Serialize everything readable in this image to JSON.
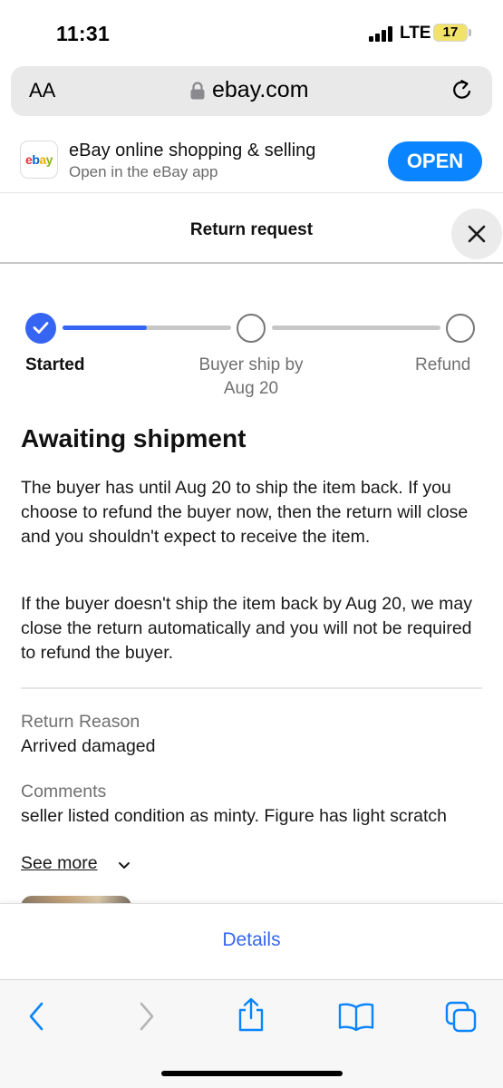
{
  "status_bar": {
    "time": "11:31",
    "network": "LTE",
    "battery": "17"
  },
  "browser": {
    "text_size_label": "AA",
    "url": "ebay.com"
  },
  "app_banner": {
    "logo_letters": [
      "e",
      "b",
      "a",
      "y"
    ],
    "title": "eBay online shopping & selling",
    "subtitle": "Open in the eBay app",
    "open_label": "OPEN"
  },
  "page": {
    "title": "Return request"
  },
  "progress": {
    "steps": [
      {
        "label": "Started",
        "state": "done"
      },
      {
        "label_line1": "Buyer ship by",
        "label_line2": "Aug 20",
        "state": "pending"
      },
      {
        "label": "Refund",
        "state": "pending"
      }
    ],
    "fill_fraction_first_segment": 0.5
  },
  "status": {
    "title": "Awaiting shipment",
    "paragraph1": "The buyer has until Aug 20 to ship the item back. If you choose to refund the buyer now, then the return will close and you shouldn't expect to receive the item.",
    "paragraph2": "If the buyer doesn't ship the item back by Aug 20, we may close the return automatically and you will not be required to refund the buyer."
  },
  "return_reason": {
    "label": "Return Reason",
    "value": "Arrived damaged"
  },
  "comments": {
    "label": "Comments",
    "value": "seller listed condition as minty. Figure has light scratch",
    "see_more": "See more"
  },
  "details": {
    "label": "Details"
  },
  "colors": {
    "accent": "#3665f3",
    "ios_blue": "#0a84ff",
    "logo_e": "#e53238",
    "logo_b": "#0064d2",
    "logo_a": "#f5af02",
    "logo_y": "#86b817"
  },
  "icons": [
    "lock-icon",
    "reload-icon",
    "close-icon",
    "check-icon",
    "chevron-down-icon",
    "back-icon",
    "forward-icon",
    "share-icon",
    "bookmarks-icon",
    "tabs-icon"
  ]
}
